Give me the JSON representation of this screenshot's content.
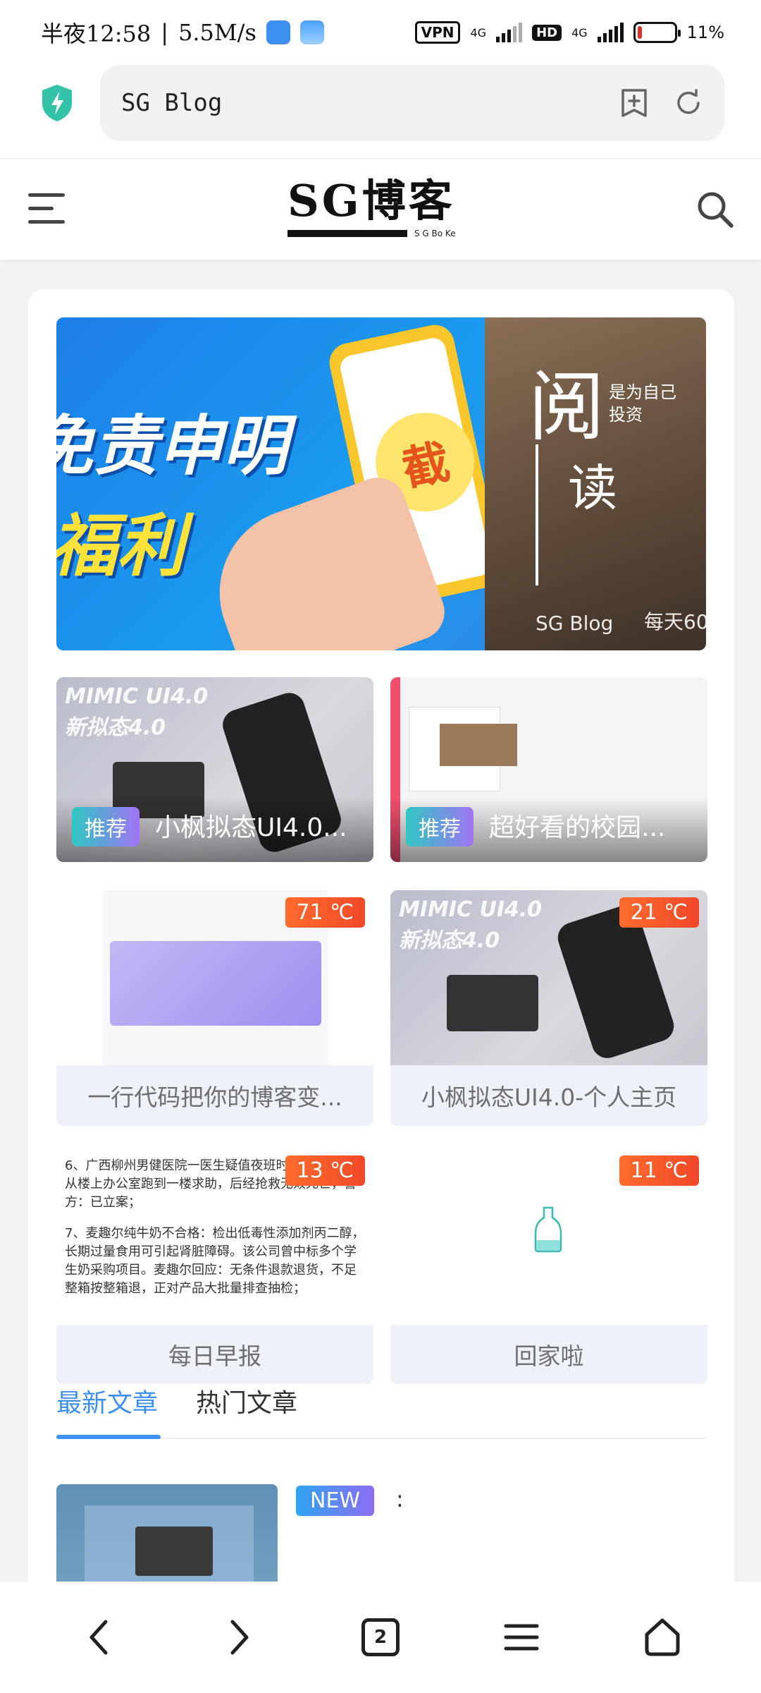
{
  "status_bar": {
    "time": "半夜12:58",
    "speed": "5.5M/s",
    "vpn_label": "VPN",
    "net1": "4G",
    "hd_label": "HD",
    "net2": "4G",
    "battery": "11%",
    "battery_level": 0.11
  },
  "browser": {
    "url_text": "SG Blog",
    "tab_count": "2"
  },
  "site": {
    "logo_text": "SG博客",
    "logo_sub": "S G Bo Ke"
  },
  "banner": {
    "left_line1": "免责申明",
    "left_line2": "福利",
    "phone_char": "截",
    "right_big": "阅",
    "right_small_1": "是为自己",
    "right_small_2": "投资",
    "right_du": "读",
    "right_blog": "SG Blog",
    "right_daily": "每天60"
  },
  "featured": [
    {
      "tag": "推荐",
      "title": "小枫拟态UI4.0...",
      "overlay": "MIMIC UI4.0\n新拟态4.0"
    },
    {
      "tag": "推荐",
      "title": "超好看的校园..."
    }
  ],
  "posts": [
    {
      "temp": "71 ℃",
      "caption": "一行代码把你的博客变..."
    },
    {
      "temp": "21 ℃",
      "caption": "小枫拟态UI4.0-个人主页",
      "overlay": "MIMIC UI4.0\n新拟态4.0"
    },
    {
      "temp": "13 ℃",
      "caption": "每日早报",
      "news_1": "6、广西柳州男健医院一医生疑值夜班时袭击，受伤后从楼上办公室跑到一楼求助，后经抢救无效死亡，警方：已立案；",
      "news_2": "7、麦趣尔纯牛奶不合格：检出低毒性添加剂丙二醇，长期过量食用可引起肾脏障碍。该公司曾中标多个学生奶采购项目。麦趣尔回应：无条件退款退货，不足整箱按整箱退，正对产品大批量排查抽检；"
    },
    {
      "temp": "11 ℃",
      "caption": "回家啦"
    }
  ],
  "tabs": [
    "最新文章",
    "热门文章"
  ],
  "article": {
    "tag": "NEW",
    "title": ":"
  }
}
